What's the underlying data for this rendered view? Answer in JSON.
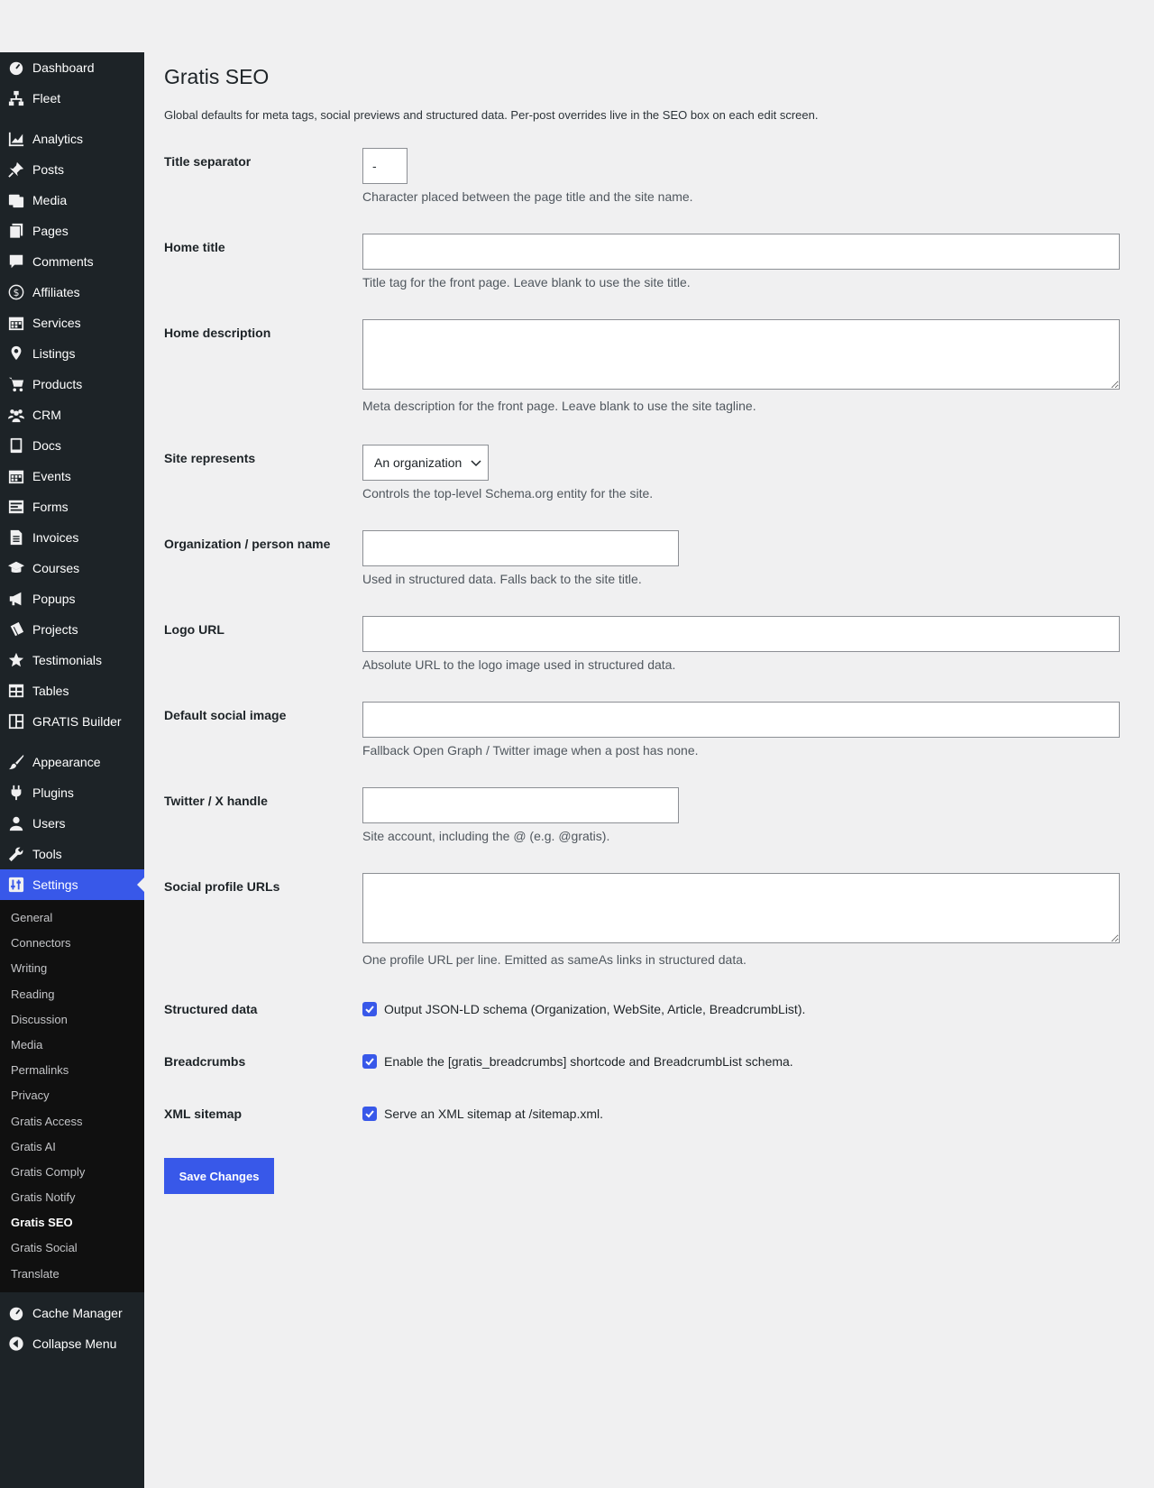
{
  "sidebar": {
    "group1": [
      {
        "label": "Dashboard",
        "icon": "dashboard-icon"
      },
      {
        "label": "Fleet",
        "icon": "network-icon"
      }
    ],
    "group2": [
      {
        "label": "Analytics",
        "icon": "chart-icon"
      },
      {
        "label": "Posts",
        "icon": "pin-icon"
      },
      {
        "label": "Media",
        "icon": "media-icon"
      },
      {
        "label": "Pages",
        "icon": "pages-icon"
      },
      {
        "label": "Comments",
        "icon": "comment-icon"
      },
      {
        "label": "Affiliates",
        "icon": "money-icon"
      },
      {
        "label": "Services",
        "icon": "calendar-icon"
      },
      {
        "label": "Listings",
        "icon": "location-icon"
      },
      {
        "label": "Products",
        "icon": "cart-icon"
      },
      {
        "label": "CRM",
        "icon": "groups-icon"
      },
      {
        "label": "Docs",
        "icon": "book-icon"
      },
      {
        "label": "Events",
        "icon": "calendar-icon"
      },
      {
        "label": "Forms",
        "icon": "form-icon"
      },
      {
        "label": "Invoices",
        "icon": "document-icon"
      },
      {
        "label": "Courses",
        "icon": "education-icon"
      },
      {
        "label": "Popups",
        "icon": "megaphone-icon"
      },
      {
        "label": "Projects",
        "icon": "tickets-icon"
      },
      {
        "label": "Testimonials",
        "icon": "star-icon"
      },
      {
        "label": "Tables",
        "icon": "table-icon"
      },
      {
        "label": "GRATIS Builder",
        "icon": "layout-icon"
      }
    ],
    "group3": [
      {
        "label": "Appearance",
        "icon": "brush-icon"
      },
      {
        "label": "Plugins",
        "icon": "plug-icon"
      },
      {
        "label": "Users",
        "icon": "user-icon"
      },
      {
        "label": "Tools",
        "icon": "wrench-icon"
      }
    ],
    "settings": {
      "label": "Settings",
      "icon": "settings-icon"
    },
    "submenu": [
      "General",
      "Connectors",
      "Writing",
      "Reading",
      "Discussion",
      "Media",
      "Permalinks",
      "Privacy",
      "Gratis Access",
      "Gratis AI",
      "Gratis Comply",
      "Gratis Notify",
      "Gratis SEO",
      "Gratis Social",
      "Translate"
    ],
    "submenu_current": "Gratis SEO",
    "group4": [
      {
        "label": "Cache Manager",
        "icon": "dashboard-icon"
      },
      {
        "label": "Collapse Menu",
        "icon": "collapse-icon"
      }
    ]
  },
  "page": {
    "title": "Gratis SEO",
    "description": "Global defaults for meta tags, social previews and structured data. Per-post overrides live in the SEO box on each edit screen."
  },
  "fields": {
    "title_separator": {
      "label": "Title separator",
      "value": "-",
      "help": "Character placed between the page title and the site name."
    },
    "home_title": {
      "label": "Home title",
      "value": "",
      "help": "Title tag for the front page. Leave blank to use the site title."
    },
    "home_description": {
      "label": "Home description",
      "value": "",
      "help": "Meta description for the front page. Leave blank to use the site tagline."
    },
    "site_represents": {
      "label": "Site represents",
      "value": "An organization",
      "help": "Controls the top-level Schema.org entity for the site."
    },
    "org_name": {
      "label": "Organization / person name",
      "value": "",
      "help": "Used in structured data. Falls back to the site title."
    },
    "logo_url": {
      "label": "Logo URL",
      "value": "",
      "help": "Absolute URL to the logo image used in structured data."
    },
    "social_image": {
      "label": "Default social image",
      "value": "",
      "help": "Fallback Open Graph / Twitter image when a post has none."
    },
    "twitter_handle": {
      "label": "Twitter / X handle",
      "value": "",
      "help": "Site account, including the @ (e.g. @gratis)."
    },
    "social_profiles": {
      "label": "Social profile URLs",
      "value": "",
      "help": "One profile URL per line. Emitted as sameAs links in structured data."
    },
    "structured_data": {
      "label": "Structured data",
      "checked": true,
      "text": "Output JSON-LD schema (Organization, WebSite, Article, BreadcrumbList)."
    },
    "breadcrumbs": {
      "label": "Breadcrumbs",
      "checked": true,
      "text": "Enable the [gratis_breadcrumbs] shortcode and BreadcrumbList schema."
    },
    "xml_sitemap": {
      "label": "XML sitemap",
      "checked": true,
      "text": "Serve an XML sitemap at /sitemap.xml."
    }
  },
  "save_label": "Save Changes",
  "colors": {
    "accent": "#3858e9",
    "sidebar_bg": "#1d2327",
    "submenu_bg": "#101010",
    "page_bg": "#f0f0f1"
  }
}
